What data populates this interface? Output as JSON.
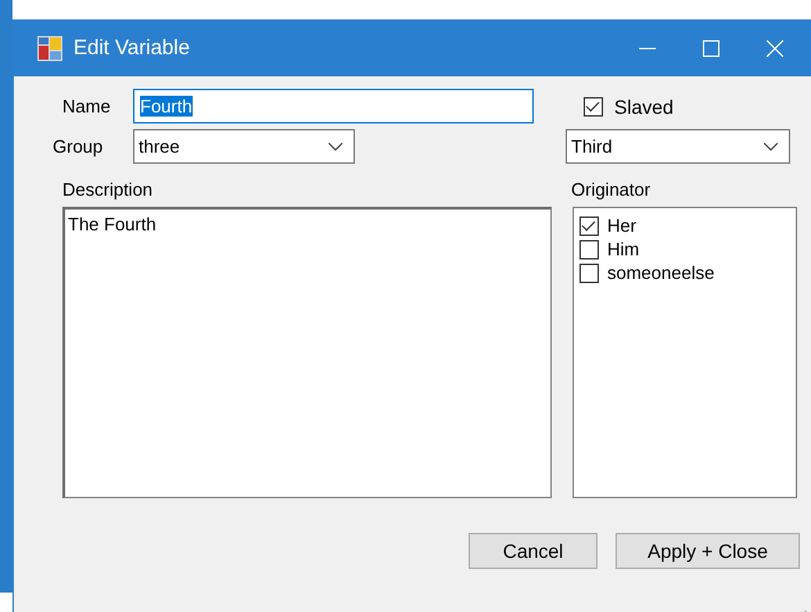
{
  "window": {
    "title": "Edit Variable"
  },
  "name": {
    "label": "Name",
    "value": "Fourth",
    "selected_text": true
  },
  "slaved": {
    "label": "Slaved",
    "checked": true
  },
  "group": {
    "label": "Group",
    "value": "three"
  },
  "group_2": {
    "value": "Third"
  },
  "description": {
    "label": "Description",
    "value": "The Fourth"
  },
  "originator": {
    "label": "Originator",
    "items": [
      {
        "label": "Her",
        "checked": true
      },
      {
        "label": "Him",
        "checked": false
      },
      {
        "label": "someoneelse",
        "checked": false
      }
    ]
  },
  "buttons": [
    "Cancel",
    "Apply + Close"
  ]
}
